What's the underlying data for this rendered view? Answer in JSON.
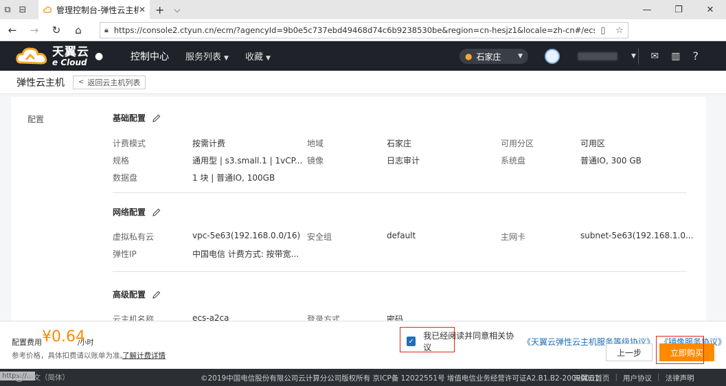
{
  "browser": {
    "tab_title": "管理控制台-弹性云主机",
    "url": "https://console2.ctyun.cn/ecm/?agencyId=9b0e5c737ebd49468d74c6b9238530be&region=cn-hesjz1&locale=zh-cn#/ecs/createVm"
  },
  "header": {
    "logo_cn": "天翼云",
    "logo_en": "e Cloud",
    "nav": [
      "控制中心",
      "服务列表",
      "收藏"
    ],
    "region": "石家庄"
  },
  "subheader": {
    "title": "弹性云主机",
    "back": "返回云主机列表"
  },
  "config": {
    "section_label": "配置",
    "basic": {
      "title": "基础配置",
      "fields": [
        {
          "label": "计费模式",
          "value": "按需计费"
        },
        {
          "label": "地域",
          "value": "石家庄"
        },
        {
          "label": "可用分区",
          "value": "可用区"
        },
        {
          "label": "规格",
          "value": "通用型 | s3.small.1 | 1vCP..."
        },
        {
          "label": "镜像",
          "value": "日志审计"
        },
        {
          "label": "系统盘",
          "value": "普通IO, 300 GB"
        },
        {
          "label": "数据盘",
          "value": "1 块 | 普通IO, 100GB"
        }
      ]
    },
    "network": {
      "title": "网络配置",
      "fields": [
        {
          "label": "虚拟私有云",
          "value": "vpc-5e63(192.168.0.0/16)"
        },
        {
          "label": "安全组",
          "value": "default"
        },
        {
          "label": "主网卡",
          "value": "subnet-5e63(192.168.1.0..."
        },
        {
          "label": "弹性IP",
          "value": "中国电信 计费方式: 按带宽..."
        }
      ]
    },
    "advanced": {
      "title": "高级配置",
      "fields": [
        {
          "label": "云主机名称",
          "value": "ecs-a2ca"
        },
        {
          "label": "登录方式",
          "value": "密码"
        }
      ]
    }
  },
  "footer": {
    "fee_label": "配置费用",
    "price": "¥0.64",
    "unit": "/小时",
    "note": "参考价格，具体扣费请以账单为准。",
    "detail_link": "了解计费详情",
    "agree_text": "我已经阅读并同意相关协议",
    "agreement1": "《天翼云弹性云主机服务等级协议》",
    "agreement2": "《镜像服务协议》",
    "prev": "上一步",
    "buy": "立即购买"
  },
  "copyright": {
    "lang": "中文（简体）",
    "url_hint": "https://...",
    "text": "©2019中国电信股份有限公司云计算分公司版权所有  京ICP备 12022551号  增值电信业务经营许可证A2.B1.B2-20090001",
    "links": [
      "天翼云首页",
      "用户协议",
      "法律声明"
    ]
  },
  "colors": {
    "accent": "#ff8a00",
    "link": "#1e6fb8",
    "header_bg": "#1f2228",
    "highlight": "#e2231a"
  }
}
